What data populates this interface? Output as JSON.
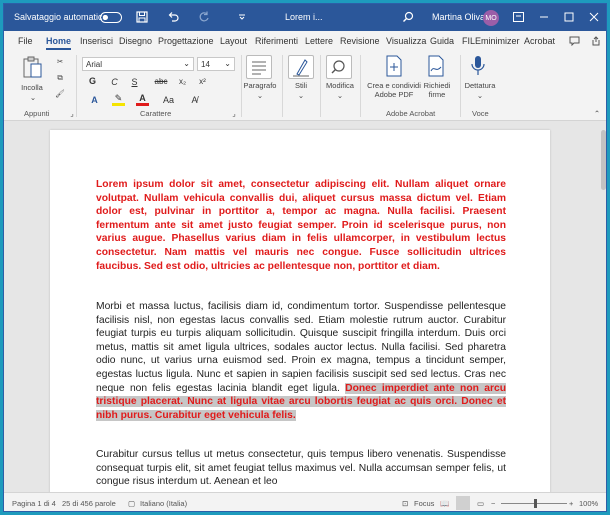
{
  "titlebar": {
    "autosave_label": "Salvataggio automatico",
    "doc_title": "Lorem i...",
    "user_name": "Martina Oliva",
    "user_initials": "MO"
  },
  "menu": {
    "tabs": [
      "File",
      "Home",
      "Inserisci",
      "Disegno",
      "Progettazione",
      "Layout",
      "Riferimenti",
      "Lettere",
      "Revisione",
      "Visualizza",
      "Guida",
      "FILEminimizer",
      "Acrobat"
    ],
    "active": "Home"
  },
  "ribbon": {
    "paste_label": "Incolla",
    "clipboard_group": "Appunti",
    "font_name": "Arial",
    "font_size": "14",
    "format_buttons": [
      "G",
      "C",
      "S",
      "abc",
      "x₂",
      "x²"
    ],
    "font_group": "Carattere",
    "paragraph_label": "Paragrafo",
    "styles_label": "Stili",
    "edit_label": "Modifica",
    "share_label_1": "Crea e condividi",
    "share_label_2": "Adobe PDF",
    "sign_label_1": "Richiedi",
    "sign_label_2": "firme",
    "adobe_group": "Adobe Acrobat",
    "dictation_label": "Dettatura",
    "voice_group": "Voce"
  },
  "document": {
    "para1": "Lorem ipsum dolor sit amet, consectetur adipiscing elit. Nullam aliquet ornare volutpat. Nullam vehicula convallis dui, aliquet cursus massa dictum vel. Etiam dolor est, pulvinar in porttitor a, tempor ac magna. Nulla facilisi. Praesent fermentum ante sit amet justo feugiat semper. Proin id scelerisque purus, non varius augue. Phasellus varius diam in felis ullamcorper, in vestibulum lectus consectetur. Nam mattis vel mauris nec congue. Fusce sollicitudin ultrices faucibus. Sed est odio, ultricies ac pellentesque non, porttitor et diam.",
    "para2_plain": "Morbi et massa luctus, facilisis diam id, condimentum tortor. Suspendisse pellentesque facilisis nisl, non egestas lacus convallis sed. Etiam molestie rutrum auctor. Curabitur feugiat turpis eu turpis aliquam sollicitudin. Quisque suscipit fringilla interdum. Duis orci metus, mattis sit amet ligula ultrices, sodales auctor lectus. Nulla facilisi. Sed pharetra odio nunc, ut varius urna euismod sed. Proin ex magna, tempus a tincidunt semper, egestas luctus ligula. Nunc et sapien in sapien facilisis suscipit sed sed lectus. Cras nec neque non felis egestas lacinia blandit eget ligula. ",
    "para2_highlight": "Donec imperdiet ante non arcu tristique placerat. Nunc at ligula vitae arcu lobortis feugiat ac quis orci. Donec et nibh purus. Curabitur eget vehicula felis.",
    "para3": "Curabitur cursus tellus ut metus consectetur, quis tempus libero venenatis. Suspendisse consequat turpis elit, sit amet feugiat tellus maximus vel. Nulla accumsan semper felis, ut congue risus interdum ut. Aenean et leo"
  },
  "status": {
    "page": "Pagina 1 di 4",
    "words": "25 di 456 parole",
    "language": "Italiano (Italia)",
    "focus": "Focus",
    "zoom": "100%"
  },
  "colors": {
    "titlebar": "#2b579a",
    "red_text": "#e01b1b",
    "highlight": "#c6c6c6",
    "desktop": "#1e9bbd"
  }
}
